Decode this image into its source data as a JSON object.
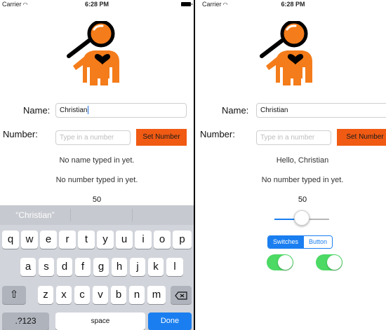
{
  "colors": {
    "accent": "#f05a13",
    "logo_orange": "#f47c1a",
    "ios_blue": "#1a7ef0",
    "switch_green": "#4cd964"
  },
  "status_bar": {
    "carrier": "Carrier",
    "wifi_icon": "wifi-icon",
    "time": "6:28 PM",
    "battery_icon": "battery-icon"
  },
  "left": {
    "name_label": "Name:",
    "name_value": "Christian",
    "number_label": "Number:",
    "number_placeholder": "Type in a number",
    "set_number_label": "Set Number",
    "name_message": "No name typed in yet.",
    "number_message": "No number typed in yet.",
    "slider_value": "50",
    "keyboard": {
      "suggestion": "“Christian”",
      "row1": [
        "q",
        "w",
        "e",
        "r",
        "t",
        "y",
        "u",
        "i",
        "o",
        "p"
      ],
      "row2": [
        "a",
        "s",
        "d",
        "f",
        "g",
        "h",
        "j",
        "k",
        "l"
      ],
      "row3": [
        "z",
        "x",
        "c",
        "v",
        "b",
        "n",
        "m"
      ],
      "shift_icon": "shift-icon",
      "backspace_icon": "backspace-icon",
      "numbers_label": ".?123",
      "space_label": "space",
      "done_label": "Done"
    }
  },
  "right": {
    "name_label": "Name:",
    "name_value": "Christian",
    "number_label": "Number:",
    "number_placeholder": "Type in a number",
    "set_number_label": "Set Number",
    "name_message": "Hello, Christian",
    "number_message": "No number typed in yet.",
    "slider_value": "50",
    "slider_fraction": 0.5,
    "segments": [
      "Switches",
      "Button"
    ],
    "selected_segment": "Switches",
    "switch_1_on": true,
    "switch_2_on": true
  }
}
